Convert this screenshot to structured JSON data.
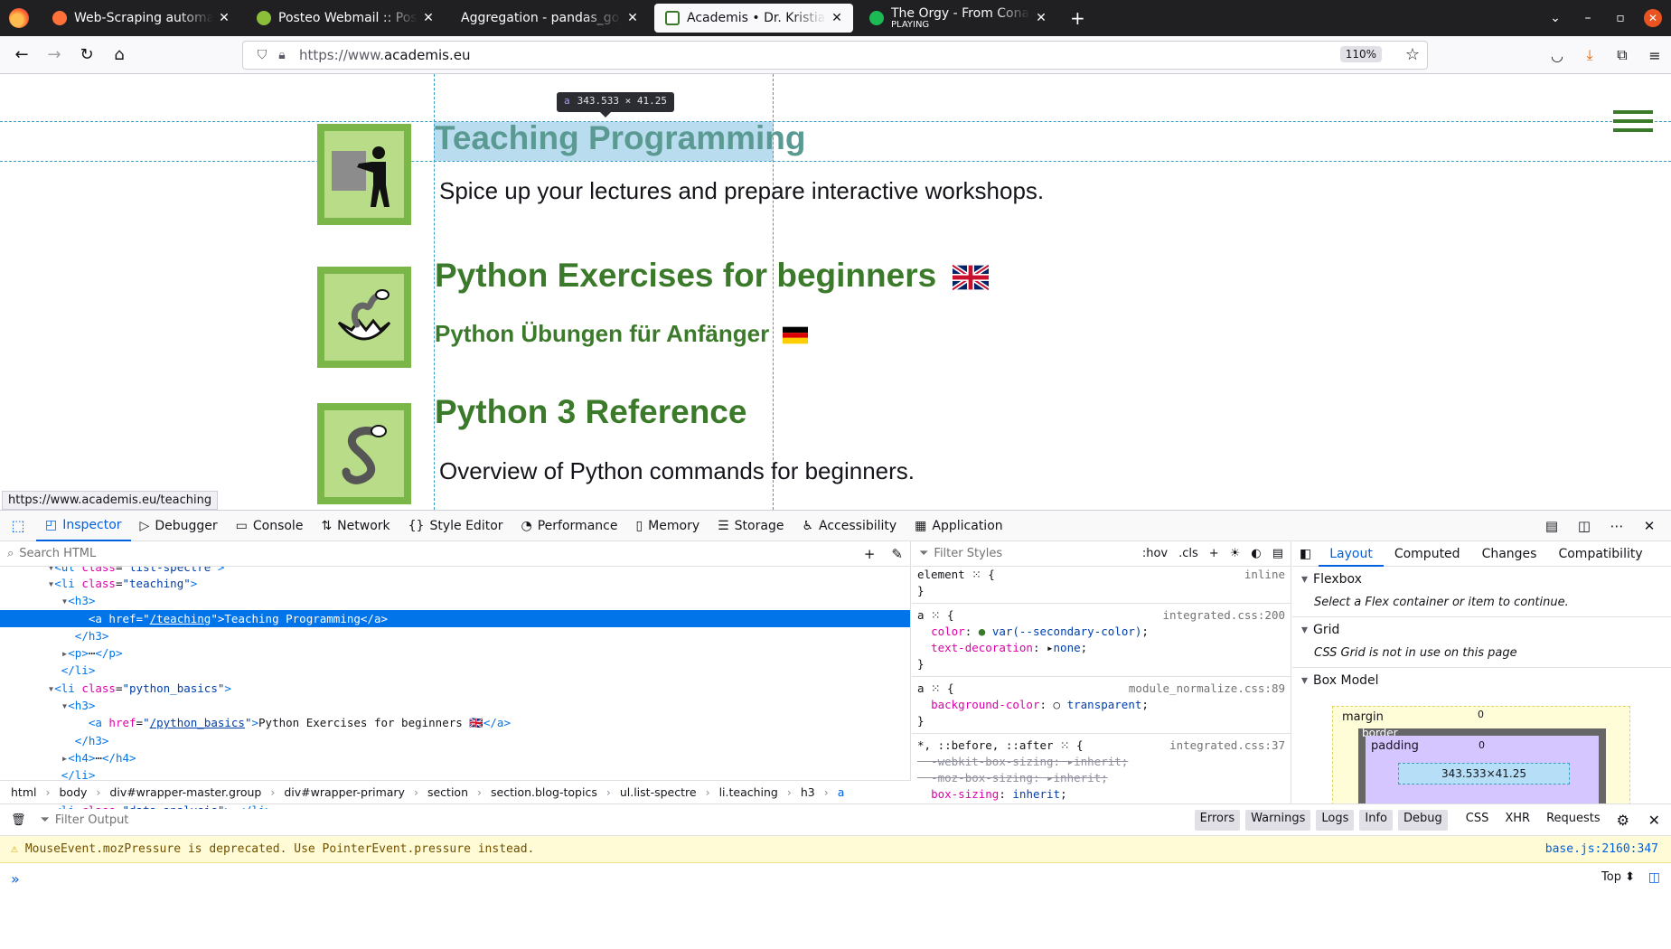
{
  "browser": {
    "tabs": [
      {
        "title": "Web-Scraping automatisiere",
        "favicon_color": "#202023",
        "active": false
      },
      {
        "title": "Posteo Webmail :: Postei",
        "favicon_color": "#8bbf3a",
        "active": false
      },
      {
        "title": "Aggregation - pandas_go_to",
        "favicon_color": "#202023",
        "active": false
      },
      {
        "title": "Academis • Dr. Kristian Ro",
        "favicon_color": "#3b7a2a",
        "active": true
      },
      {
        "title": "The Orgy - From Conan th",
        "subtitle": "PLAYING",
        "favicon_color": "#1db954",
        "active": false
      }
    ],
    "url_prefix": "https://www.",
    "url_domain": "academis.eu",
    "zoom": "110%",
    "status_url": "https://www.academis.eu/teaching"
  },
  "page": {
    "tooltip_tag": "a",
    "tooltip_size": "343.533 × 41.25",
    "topics": [
      {
        "title": "Teaching Programming",
        "subtitle": "Spice up your lectures and prepare interactive workshops."
      },
      {
        "title": "Python Exercises for beginners",
        "h4": "Python Übungen für Anfänger"
      },
      {
        "title": "Python 3 Reference",
        "subtitle": "Overview of Python commands for beginners."
      }
    ]
  },
  "devtools": {
    "tabs": [
      "Inspector",
      "Debugger",
      "Console",
      "Network",
      "Style Editor",
      "Performance",
      "Memory",
      "Storage",
      "Accessibility",
      "Application"
    ],
    "search_placeholder": "Search HTML",
    "filter_styles_placeholder": "Filter Styles",
    "hov": ":hov",
    "cls": ".cls",
    "breadcrumbs": [
      "html",
      "body",
      "div#wrapper-master.group",
      "div#wrapper-primary",
      "section",
      "section.blog-topics",
      "ul.list-spectre",
      "li.teaching",
      "h3",
      "a"
    ],
    "rules": {
      "element_selector": "element",
      "element_src": "inline",
      "rule1_src": "integrated.css:200",
      "rule1_color": "var(--secondary-color)",
      "rule1_deco": "none",
      "rule2_src": "module_normalize.css:89",
      "rule2_bg": "transparent",
      "rule3_selector": "*, ::before, ::after",
      "rule3_src": "integrated.css:37",
      "webkit": "-webkit-box-sizing",
      "moz": "-moz-box-sizing",
      "inherit": "inherit",
      "box_sizing": "box-sizing",
      "margin": "margin",
      "padding": "padding",
      "zero": "0"
    },
    "layout_tabs": [
      "Layout",
      "Computed",
      "Changes",
      "Compatibility"
    ],
    "flexbox_label": "Flexbox",
    "flexbox_note": "Select a Flex container or item to continue.",
    "grid_label": "Grid",
    "grid_note": "CSS Grid is not in use on this page",
    "boxmodel_label": "Box Model",
    "bm": {
      "margin": "margin",
      "border": "border",
      "padding": "padding",
      "content": "343.533×41.25",
      "zero": "0"
    },
    "console": {
      "filter_placeholder": "Filter Output",
      "filters": [
        "Errors",
        "Warnings",
        "Logs",
        "Info",
        "Debug",
        "CSS",
        "XHR",
        "Requests"
      ],
      "warning": "MouseEvent.mozPressure is deprecated. Use PointerEvent.pressure instead.",
      "warning_loc": "base.js:2160:347",
      "context": "Top"
    }
  }
}
